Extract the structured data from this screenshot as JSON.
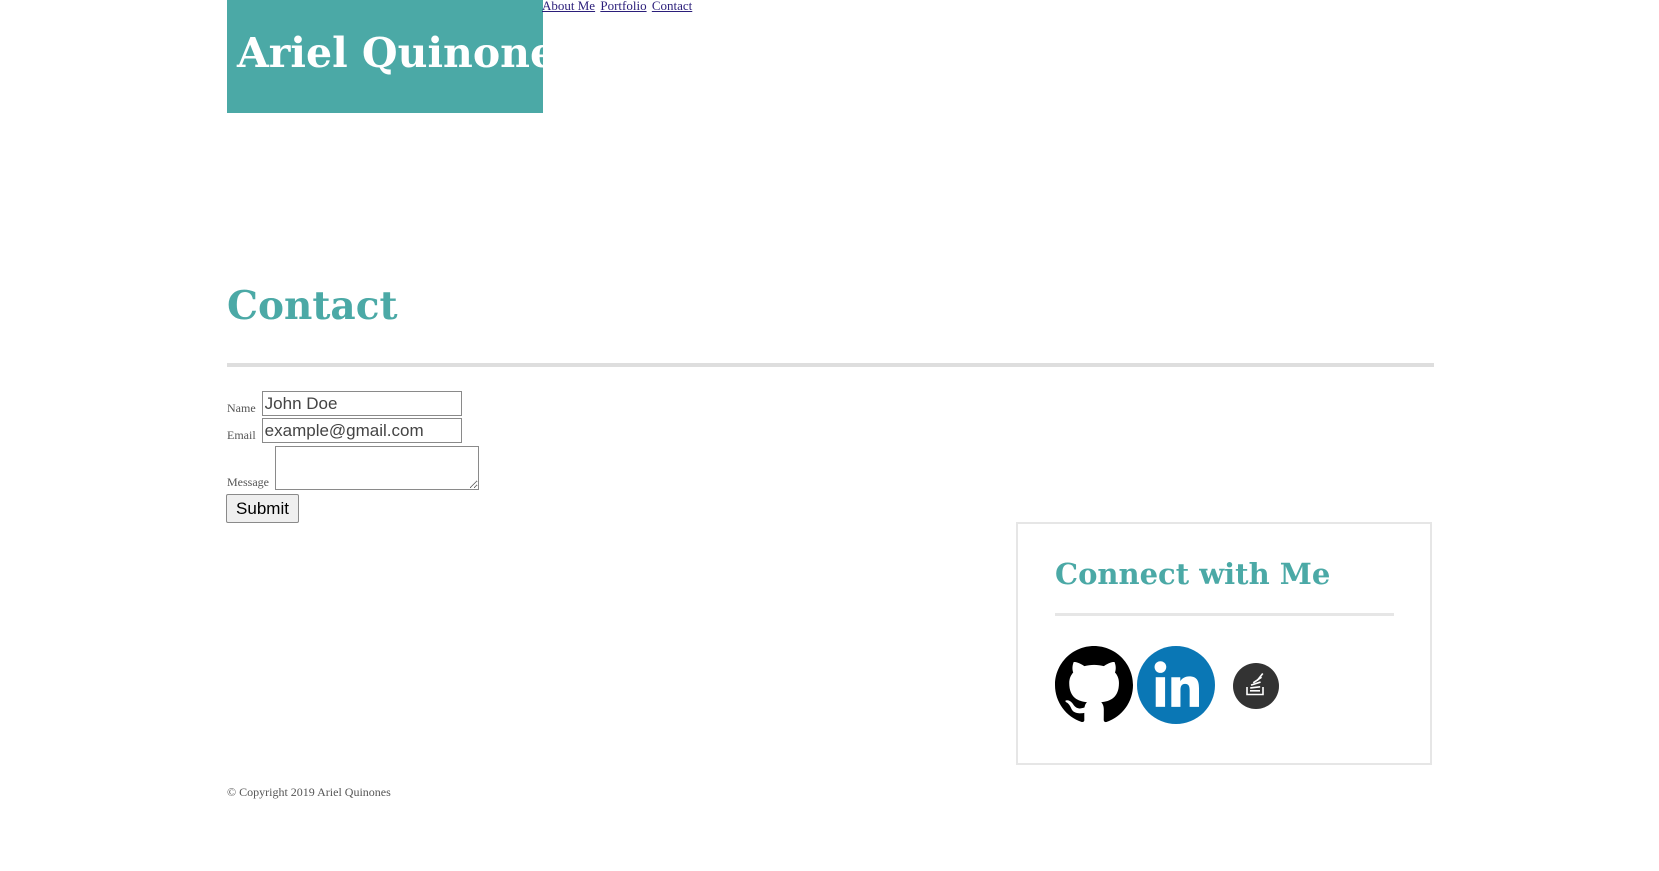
{
  "header": {
    "brand": "Ariel Quinones",
    "nav": [
      "About Me",
      "Portfolio",
      "Contact"
    ]
  },
  "main": {
    "title": "Contact",
    "form": {
      "name_label": "Name",
      "name_value": "John Doe",
      "email_label": "Email",
      "email_value": "example@gmail.com",
      "message_label": "Message",
      "message_value": "",
      "submit_label": "Submit"
    }
  },
  "connect": {
    "title": "Connect with Me",
    "icons": [
      "github-icon",
      "linkedin-icon",
      "stackoverflow-icon"
    ]
  },
  "footer": {
    "copyright": "© Copyright 2019 Ariel Quinones"
  },
  "colors": {
    "accent": "#4ba9a6",
    "linkedin": "#0a77b5",
    "stackoverflow_bg": "#333333",
    "divider": "#dedede"
  }
}
